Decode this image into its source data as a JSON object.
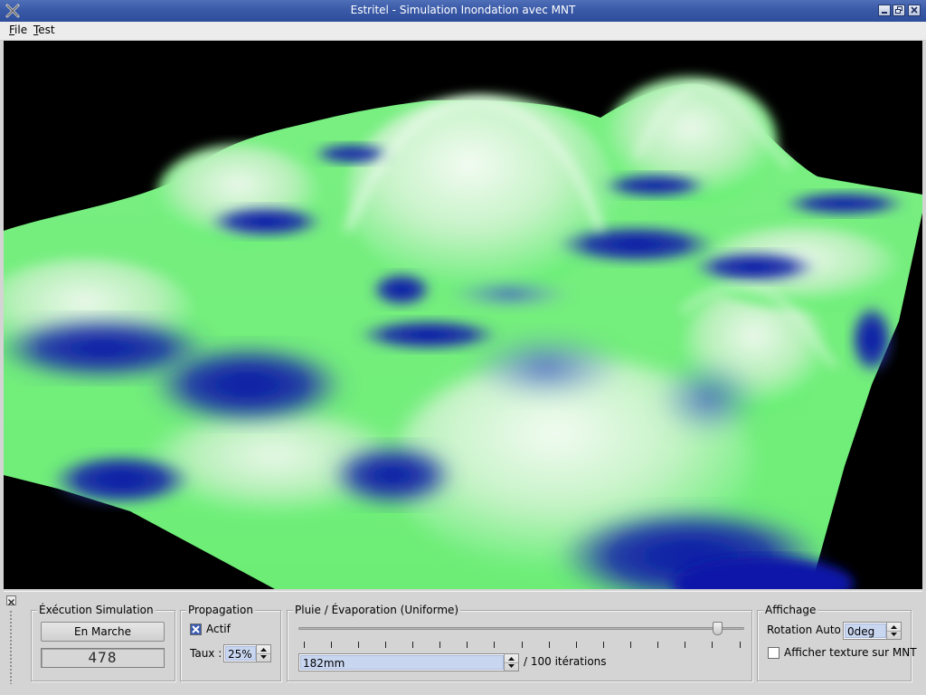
{
  "window": {
    "title": "Estritel - Simulation Inondation avec MNT"
  },
  "menu": {
    "file": {
      "mnemonic": "F",
      "rest": "ile"
    },
    "test": {
      "mnemonic": "T",
      "rest": "est"
    }
  },
  "execution": {
    "legend": "Éxécution Simulation",
    "run_button": "En Marche",
    "counter": "478"
  },
  "propagation": {
    "legend": "Propagation",
    "active_label": "Actif",
    "active_checked": true,
    "rate_label": "Taux :",
    "rate_value": "25%"
  },
  "rain": {
    "legend": "Pluie / Évaporation (Uniforme)",
    "slider_position": 0.95,
    "slider_tick_count": 17,
    "amount_value": "182mm",
    "iterations_suffix": "/ 100 itérations"
  },
  "display": {
    "legend": "Affichage",
    "rotation_label": "Rotation Auto :",
    "rotation_value": "0deg",
    "texture_label": "Afficher texture sur MNT",
    "texture_checked": false
  },
  "colors": {
    "titlebar": "#3a5aa8",
    "terrain_green": "#5cf06a",
    "terrain_light": "#e4f6e4",
    "water_blue": "#0a1a9e",
    "viewport_bg": "#000000"
  }
}
